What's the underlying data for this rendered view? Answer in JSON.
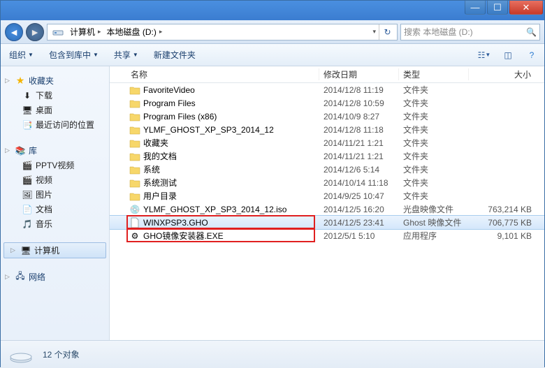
{
  "window": {
    "min": "—",
    "max": "☐",
    "close": "✕"
  },
  "breadcrumb": {
    "seg1": "计算机",
    "seg2": "本地磁盘 (D:)"
  },
  "search": {
    "placeholder": "搜索 本地磁盘 (D:)"
  },
  "toolbar": {
    "organize": "组织",
    "include": "包含到库中",
    "share": "共享",
    "newfolder": "新建文件夹"
  },
  "sidebar": {
    "fav_head": "收藏夹",
    "fav_items": [
      "下载",
      "桌面",
      "最近访问的位置"
    ],
    "lib_head": "库",
    "lib_items": [
      "PPTV视频",
      "视频",
      "图片",
      "文档",
      "音乐"
    ],
    "computer": "计算机",
    "network": "网络"
  },
  "columns": {
    "name": "名称",
    "date": "修改日期",
    "type": "类型",
    "size": "大小"
  },
  "files": [
    {
      "name": "FavoriteVideo",
      "date": "2014/12/8 11:19",
      "type": "文件夹",
      "size": "",
      "icon": "folder"
    },
    {
      "name": "Program Files",
      "date": "2014/12/8 10:59",
      "type": "文件夹",
      "size": "",
      "icon": "folder"
    },
    {
      "name": "Program Files (x86)",
      "date": "2014/10/9 8:27",
      "type": "文件夹",
      "size": "",
      "icon": "folder"
    },
    {
      "name": "YLMF_GHOST_XP_SP3_2014_12",
      "date": "2014/12/8 11:18",
      "type": "文件夹",
      "size": "",
      "icon": "folder"
    },
    {
      "name": "收藏夹",
      "date": "2014/11/21 1:21",
      "type": "文件夹",
      "size": "",
      "icon": "folder"
    },
    {
      "name": "我的文档",
      "date": "2014/11/21 1:21",
      "type": "文件夹",
      "size": "",
      "icon": "folder"
    },
    {
      "name": "系统",
      "date": "2014/12/6 5:14",
      "type": "文件夹",
      "size": "",
      "icon": "folder"
    },
    {
      "name": "系统测试",
      "date": "2014/10/14 11:18",
      "type": "文件夹",
      "size": "",
      "icon": "folder"
    },
    {
      "name": "用户目录",
      "date": "2014/9/25 10:47",
      "type": "文件夹",
      "size": "",
      "icon": "folder"
    },
    {
      "name": "YLMF_GHOST_XP_SP3_2014_12.iso",
      "date": "2014/12/5 16:20",
      "type": "光盘映像文件",
      "size": "763,214 KB",
      "icon": "iso"
    },
    {
      "name": "WINXPSP3.GHO",
      "date": "2014/12/5 23:41",
      "type": "Ghost 映像文件",
      "size": "706,775 KB",
      "icon": "file",
      "sel": true
    },
    {
      "name": "GHO镜像安装器.EXE",
      "date": "2012/5/1 5:10",
      "type": "应用程序",
      "size": "9,101 KB",
      "icon": "exe"
    }
  ],
  "status": {
    "count": "12 个对象"
  }
}
